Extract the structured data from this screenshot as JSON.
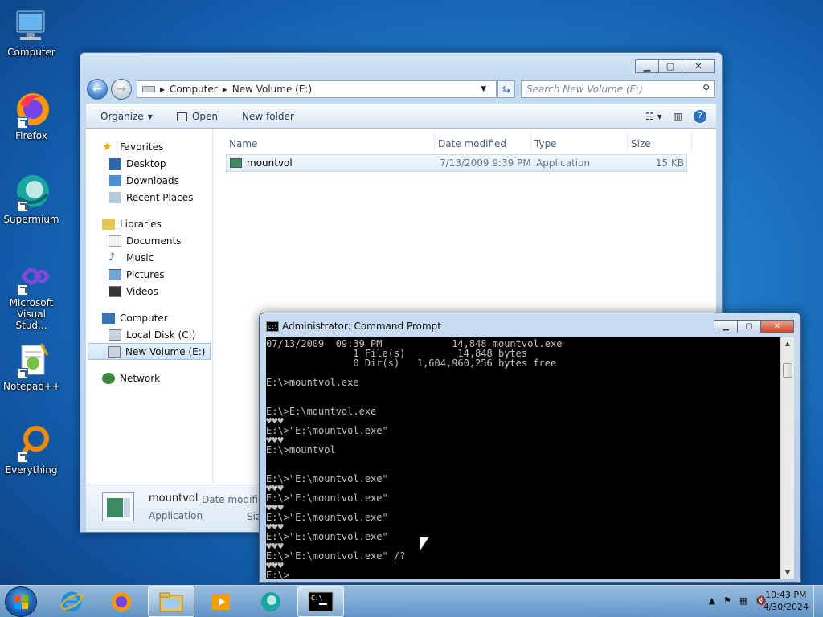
{
  "desktop": {
    "icons": [
      {
        "label": "Computer",
        "icon": "computer-icon"
      },
      {
        "label": "Firefox",
        "icon": "firefox-icon"
      },
      {
        "label": "Supermium",
        "icon": "supermium-icon"
      },
      {
        "label": "Microsoft Visual Stud...",
        "icon": "visual-studio-icon"
      },
      {
        "label": "Notepad++",
        "icon": "notepadpp-icon"
      },
      {
        "label": "Everything",
        "icon": "everything-icon"
      }
    ]
  },
  "explorer": {
    "breadcrumb": [
      "Computer",
      "New Volume (E:)"
    ],
    "search_placeholder": "Search New Volume (E:)",
    "toolbar": {
      "organize": "Organize",
      "open": "Open",
      "new_folder": "New folder"
    },
    "nav": {
      "favorites": "Favorites",
      "desktop": "Desktop",
      "downloads": "Downloads",
      "recent": "Recent Places",
      "libraries": "Libraries",
      "documents": "Documents",
      "music": "Music",
      "pictures": "Pictures",
      "videos": "Videos",
      "computer": "Computer",
      "local_disk": "Local Disk (C:)",
      "new_volume": "New Volume (E:)",
      "network": "Network"
    },
    "columns": {
      "name": "Name",
      "date": "Date modified",
      "type": "Type",
      "size": "Size"
    },
    "files": [
      {
        "name": "mountvol",
        "date": "7/13/2009 9:39 PM",
        "type": "Application",
        "size": "15 KB"
      }
    ],
    "details": {
      "name": "mountvol",
      "type": "Application",
      "date_label": "Date modified",
      "size_label": "Siz"
    }
  },
  "cmd": {
    "title": "Administrator: Command Prompt",
    "lines": [
      "07/13/2009  09:39 PM            14,848 mountvol.exe",
      "               1 File(s)         14,848 bytes",
      "               0 Dir(s)   1,604,960,256 bytes free",
      "",
      "E:\\>mountvol.exe",
      "",
      "",
      "E:\\>E:\\mountvol.exe",
      "♥♥♥",
      "E:\\>\"E:\\mountvol.exe\"",
      "♥♥♥",
      "E:\\>mountvol",
      "",
      "",
      "E:\\>\"E:\\mountvol.exe\"",
      "♥♥♥",
      "E:\\>\"E:\\mountvol.exe\"",
      "♥♥♥",
      "E:\\>\"E:\\mountvol.exe\"",
      "♥♥♥",
      "E:\\>\"E:\\mountvol.exe\"",
      "♥♥♥",
      "E:\\>\"E:\\mountvol.exe\" /?",
      "♥♥♥",
      "E:\\>"
    ]
  },
  "taskbar": {
    "apps": [
      "internet-explorer",
      "firefox",
      "file-explorer",
      "media-player",
      "supermium",
      "command-prompt"
    ],
    "time": "10:43 PM",
    "date": "4/30/2024"
  },
  "colors": {
    "console_bg": "#000000",
    "console_fg": "#c0c0c0",
    "accent": "#2f6fbf"
  }
}
